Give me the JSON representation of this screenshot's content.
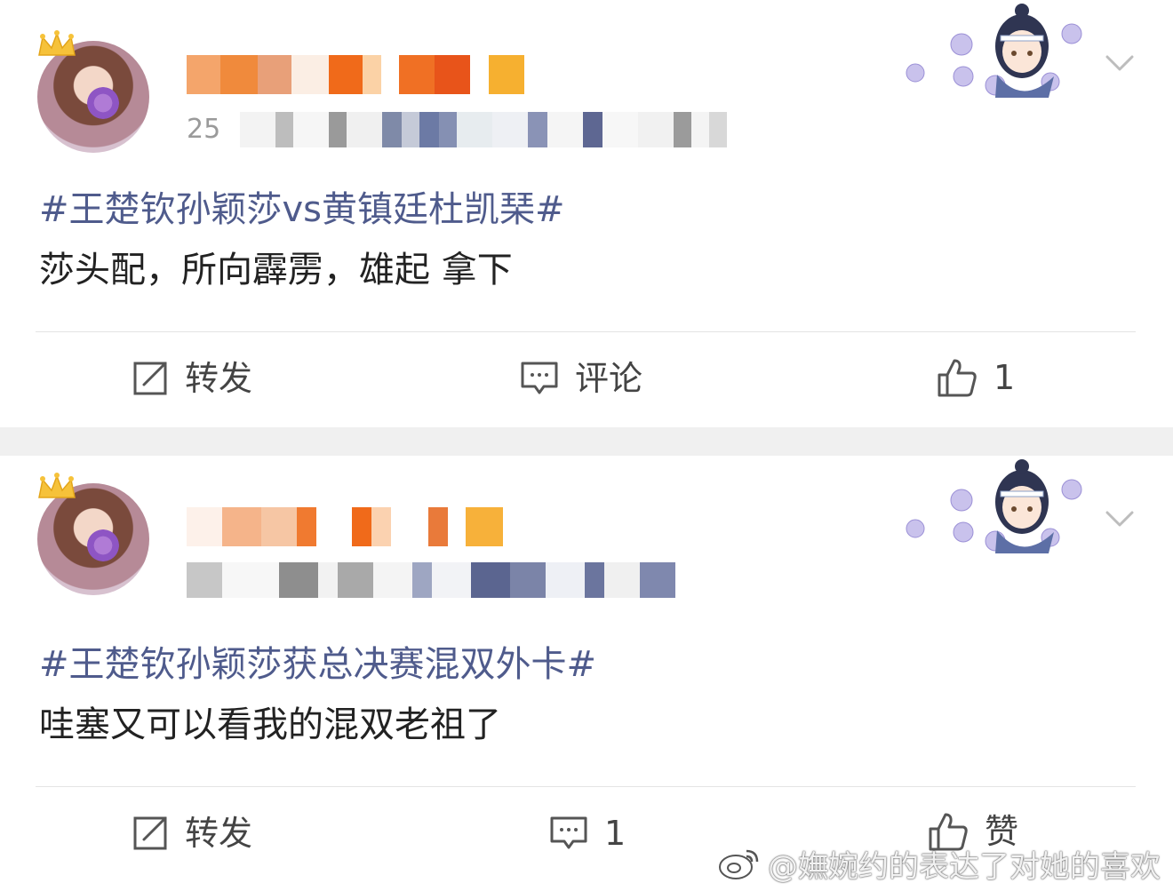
{
  "posts": [
    {
      "meta_prefix": "25",
      "hashtag": "#王楚钦孙颖莎vs黄镇廷杜凯琹#",
      "text": "莎头配，所向霹雳，雄起 拿下",
      "actions": {
        "repost_label": "转发",
        "comment_label": "评论",
        "like_label": "1"
      }
    },
    {
      "meta_prefix": "",
      "hashtag": "#王楚钦孙颖莎获总决赛混双外卡#",
      "text": "哇塞又可以看我的混双老祖了",
      "actions": {
        "repost_label": "转发",
        "comment_label": "1",
        "like_label": "赞"
      }
    }
  ],
  "watermark": "@嫵婉约的表达了对她的喜欢",
  "icons": {
    "repost": "repost-icon",
    "comment": "comment-icon",
    "like": "thumbs-up-icon",
    "more": "chevron-down-icon",
    "crown": "crown-icon",
    "weibo": "weibo-logo-icon"
  },
  "colors": {
    "hashtag": "#4f5b8c",
    "text": "#222222",
    "separator": "#f0f0f0"
  }
}
